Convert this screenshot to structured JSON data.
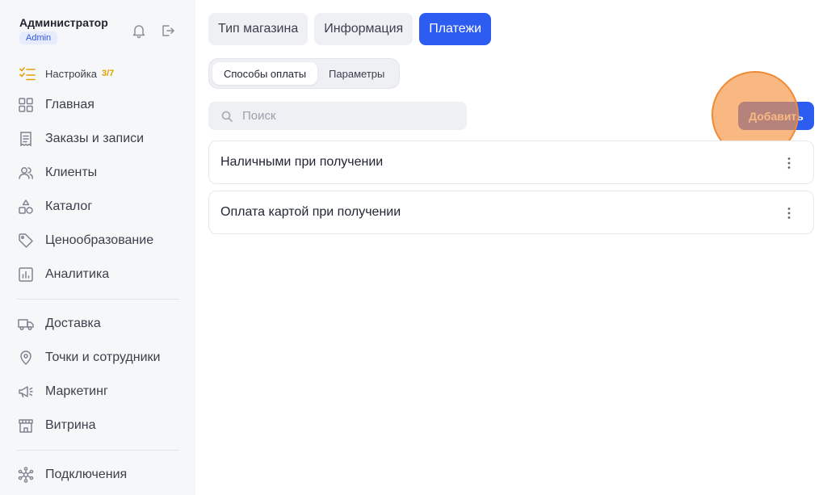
{
  "user": {
    "name": "Администратор",
    "role": "Admin"
  },
  "sidebar": {
    "setup": {
      "label": "Настройка",
      "count": "3/7"
    },
    "items": [
      {
        "label": "Главная",
        "icon": "grid-icon"
      },
      {
        "label": "Заказы и записи",
        "icon": "receipt-icon"
      },
      {
        "label": "Клиенты",
        "icon": "users-icon"
      },
      {
        "label": "Каталог",
        "icon": "shapes-icon"
      },
      {
        "label": "Ценообразование",
        "icon": "tag-icon"
      },
      {
        "label": "Аналитика",
        "icon": "chart-icon"
      },
      {
        "label": "Доставка",
        "icon": "truck-icon"
      },
      {
        "label": "Точки и сотрудники",
        "icon": "map-pin-icon"
      },
      {
        "label": "Маркетинг",
        "icon": "megaphone-icon"
      },
      {
        "label": "Витрина",
        "icon": "storefront-icon"
      },
      {
        "label": "Подключения",
        "icon": "network-icon"
      }
    ]
  },
  "tabs": [
    {
      "label": "Тип магазина",
      "active": false
    },
    {
      "label": "Информация",
      "active": false
    },
    {
      "label": "Платежи",
      "active": true
    }
  ],
  "subtabs": [
    {
      "label": "Способы оплаты",
      "active": true
    },
    {
      "label": "Параметры",
      "active": false
    }
  ],
  "search": {
    "placeholder": "Поиск",
    "value": ""
  },
  "add_label": "Добавить",
  "payment_methods": [
    {
      "label": "Наличными при получении"
    },
    {
      "label": "Оплата картой при получении"
    }
  ],
  "colors": {
    "accent": "#2c5cf0",
    "setup_count": "#e0a100",
    "click_highlight": "#f08a32"
  }
}
